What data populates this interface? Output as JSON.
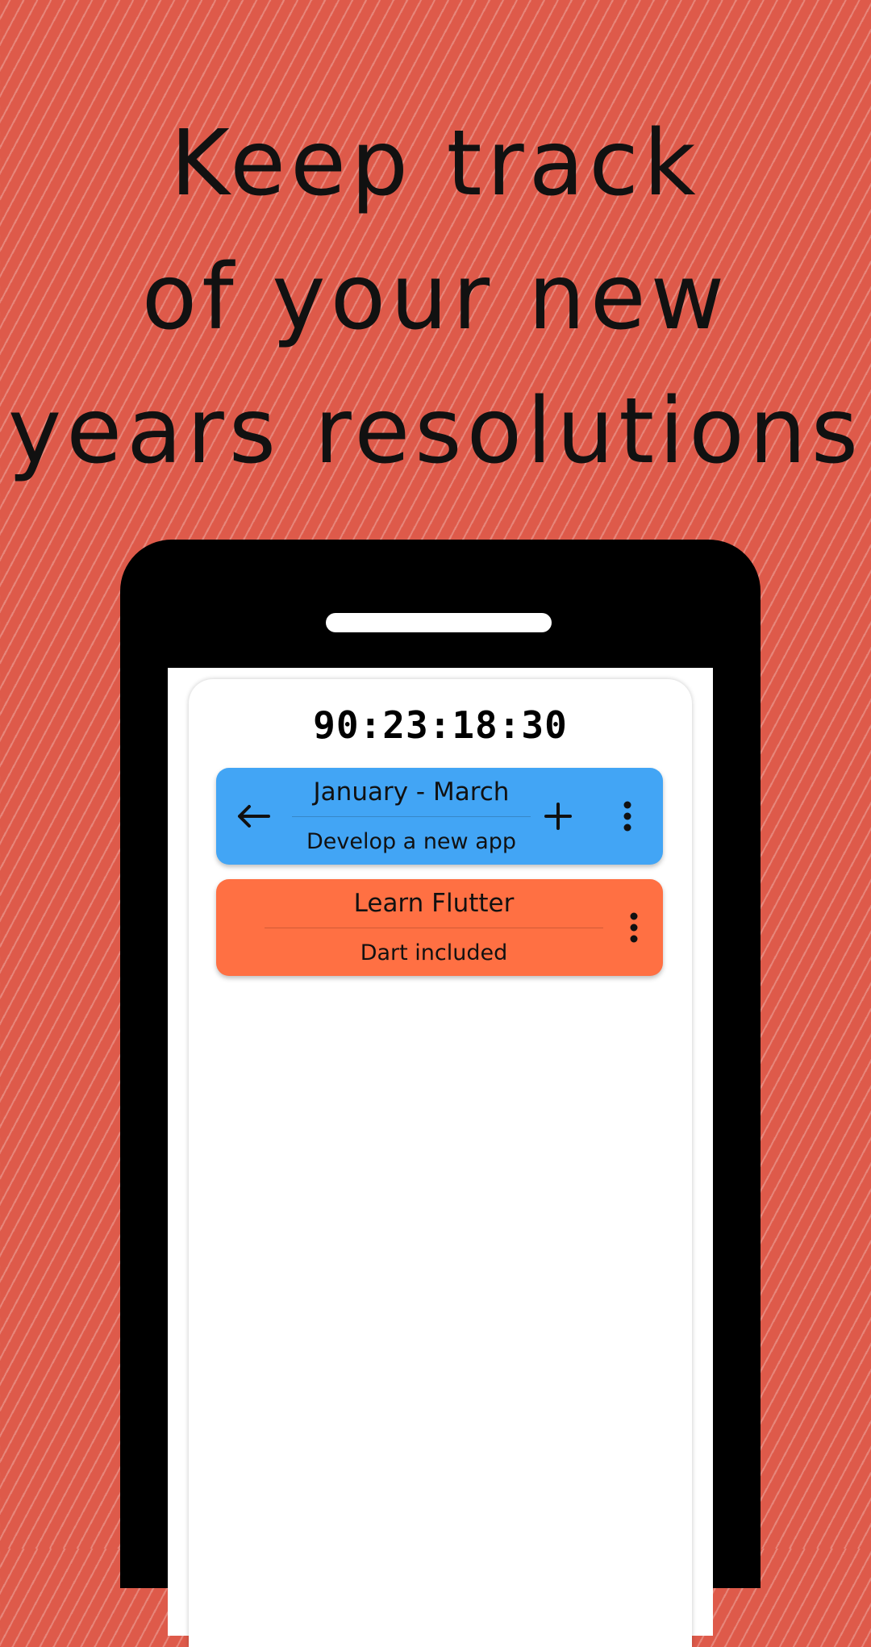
{
  "headline": {
    "line1": "Keep track",
    "line2": "of your new",
    "line3": "years resolutions"
  },
  "app": {
    "timer": "90:23:18:30",
    "cards": [
      {
        "title": "January - March",
        "subtitle": "Develop a new app",
        "color": "#42a5f5",
        "back_icon": "arrow-left-icon",
        "add_icon": "plus-icon",
        "more_icon": "more-vertical-icon"
      },
      {
        "title": "Learn Flutter",
        "subtitle": "Dart included",
        "color": "#ff7043",
        "more_icon": "more-vertical-icon"
      }
    ]
  },
  "colors": {
    "background": "#de5a4a",
    "phone_frame": "#000000",
    "screen": "#ffffff"
  }
}
